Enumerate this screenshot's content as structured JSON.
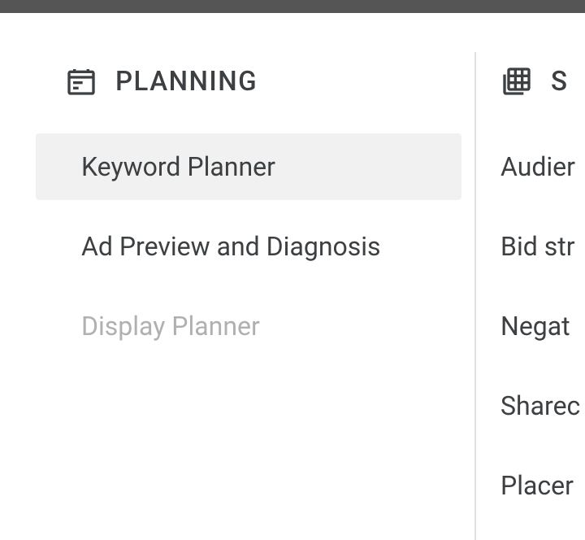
{
  "left": {
    "header": "PLANNING",
    "items": [
      {
        "label": "Keyword Planner",
        "state": "selected"
      },
      {
        "label": "Ad Preview and Diagnosis",
        "state": "normal"
      },
      {
        "label": "Display Planner",
        "state": "disabled"
      }
    ]
  },
  "right": {
    "header": "S",
    "items": [
      {
        "label": "Audier"
      },
      {
        "label": "Bid str"
      },
      {
        "label": "Negat"
      },
      {
        "label": "Sharec"
      },
      {
        "label": "Placer"
      }
    ]
  }
}
